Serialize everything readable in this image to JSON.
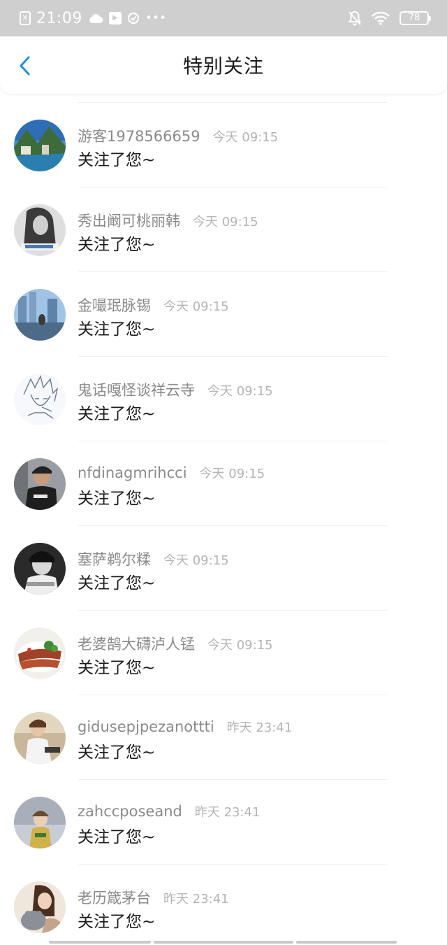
{
  "status_bar": {
    "time": "21:09",
    "battery": "78",
    "sim_icon": "no-sim-icon",
    "cloud_icon": "cloud-icon",
    "video_icon": "video-icon",
    "sync_icon": "sync-icon",
    "more_icon": "more-dots-icon",
    "mute_icon": "bell-off-icon",
    "wifi_icon": "wifi-icon"
  },
  "nav": {
    "title": "特别关注",
    "back_icon": "chevron-left-icon",
    "accent": "#1e90e0"
  },
  "items": [
    {
      "name": "游客1978566659",
      "time": "今天 09:15",
      "message": "关注了您~",
      "avatar": "landscape-avatar"
    },
    {
      "name": "秀出阚可桃丽韩",
      "time": "今天 09:15",
      "message": "关注了您~",
      "avatar": "woman-sketch-avatar"
    },
    {
      "name": "金嘬珉脉锡",
      "time": "今天 09:15",
      "message": "关注了您~",
      "avatar": "city-street-avatar"
    },
    {
      "name": "鬼话嘎怪谈祥云寺",
      "time": "今天 09:15",
      "message": "关注了您~",
      "avatar": "anime-sketch-avatar"
    },
    {
      "name": "nfdinagmrihcci",
      "time": "今天 09:15",
      "message": "关注了您~",
      "avatar": "capped-man-avatar"
    },
    {
      "name": "塞萨鹈尔糅",
      "time": "今天 09:15",
      "message": "关注了您~",
      "avatar": "bw-portrait-avatar"
    },
    {
      "name": "老婆鹄大礴泸人锰",
      "time": "今天 09:15",
      "message": "关注了您~",
      "avatar": "food-avatar"
    },
    {
      "name": "gidusepjpezanottti",
      "time": "昨天 23:41",
      "message": "关注了您~",
      "avatar": "sitting-person-avatar"
    },
    {
      "name": "zahccposeand",
      "time": "昨天 23:41",
      "message": "关注了您~",
      "avatar": "child-avatar"
    },
    {
      "name": "老历箴茅台",
      "time": "昨天 23:41",
      "message": "关注了您~",
      "avatar": "woman-cat-avatar"
    }
  ]
}
